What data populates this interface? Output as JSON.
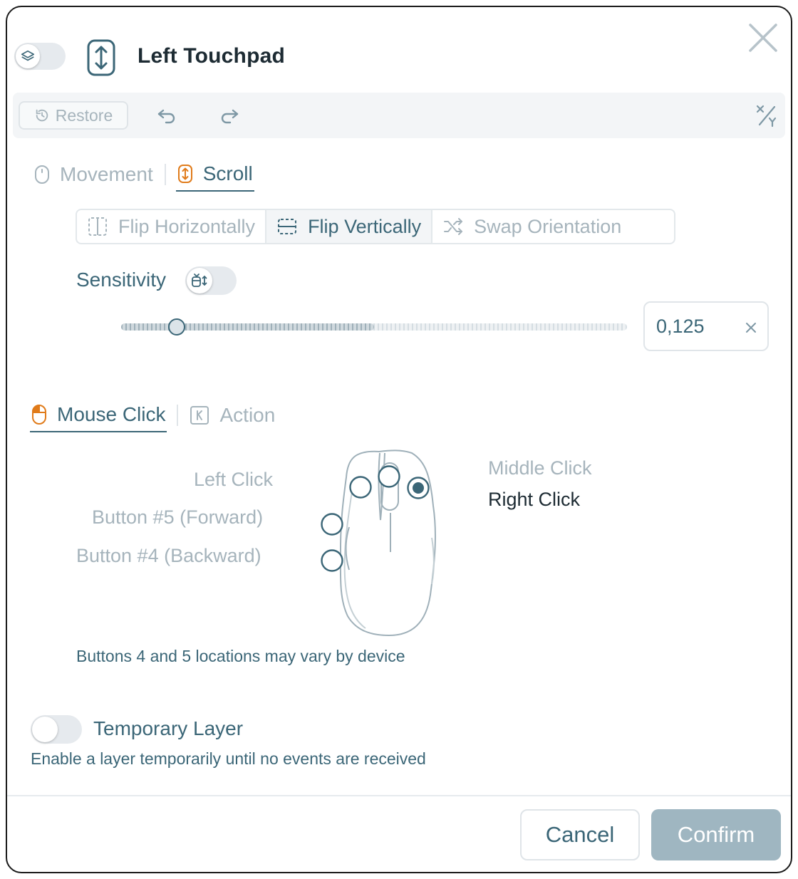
{
  "header": {
    "title": "Left Touchpad",
    "layer_toggle_icon": "layers-icon",
    "device_icon": "touchpad-scroll-icon",
    "close_icon": "close-icon"
  },
  "toolbar": {
    "restore_label": "Restore",
    "restore_icon": "restore-icon",
    "undo_icon": "undo-icon",
    "redo_icon": "redo-icon",
    "swap_xy_icon": "swap-xy-icon"
  },
  "axis_tabs": [
    {
      "label": "Movement",
      "icon": "mouse-outline-icon",
      "active": false
    },
    {
      "label": "Scroll",
      "icon": "scroll-icon",
      "active": true
    }
  ],
  "transforms": [
    {
      "label": "Flip Horizontally",
      "icon": "flip-horizontal-icon",
      "selected": false
    },
    {
      "label": "Flip Vertically",
      "icon": "flip-vertical-icon",
      "selected": true
    },
    {
      "label": "Swap Orientation",
      "icon": "shuffle-icon",
      "selected": false
    }
  ],
  "sensitivity": {
    "label": "Sensitivity",
    "toggle_icon": "sensitivity-mode-icon",
    "slider_fraction": 0.11,
    "value": "0,125",
    "clear_icon": "clear-icon"
  },
  "click_tabs": [
    {
      "label": "Mouse Click",
      "icon": "mouse-left-click-icon",
      "active": true
    },
    {
      "label": "Action",
      "icon": "keyboard-key-icon",
      "active": false
    }
  ],
  "mouse_buttons": {
    "left_click": "Left Click",
    "button5": "Button #5 (Forward)",
    "button4": "Button #4 (Backward)",
    "middle_click": "Middle Click",
    "right_click": "Right Click",
    "selected": "right_click"
  },
  "hint": "Buttons 4 and 5 locations may vary by device",
  "temporary_layer": {
    "label": "Temporary Layer",
    "description": "Enable a layer temporarily until no events are received",
    "enabled": false
  },
  "footer": {
    "cancel_label": "Cancel",
    "confirm_label": "Confirm"
  },
  "colors": {
    "accent": "#3b6677",
    "accent_orange": "#e07b1a",
    "muted": "#a6b4bc",
    "confirm_bg": "#9fb6c1"
  }
}
